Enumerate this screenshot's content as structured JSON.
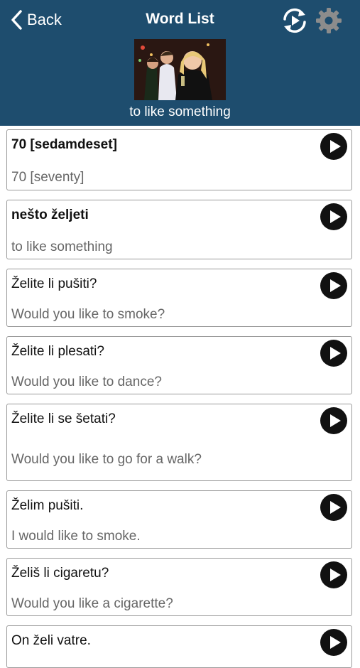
{
  "nav": {
    "back_label": "Back",
    "title": "Word List"
  },
  "header": {
    "subtitle": "to like something"
  },
  "items": [
    {
      "source": "70 [sedamdeset]",
      "translation": "70 [seventy]"
    },
    {
      "source": "nešto željeti",
      "translation": "to like something"
    },
    {
      "source": "Želite li pušiti?",
      "translation": "Would you like to smoke?"
    },
    {
      "source": "Želite li plesati?",
      "translation": "Would you like to dance?"
    },
    {
      "source": "Želite li se šetati?",
      "translation": "Would you like to go for a walk?"
    },
    {
      "source": "Želim pušiti.",
      "translation": "I would like to smoke."
    },
    {
      "source": "Želiš li cigaretu?",
      "translation": "Would you like a cigarette?"
    },
    {
      "source": "On želi vatre.",
      "translation": ""
    }
  ]
}
